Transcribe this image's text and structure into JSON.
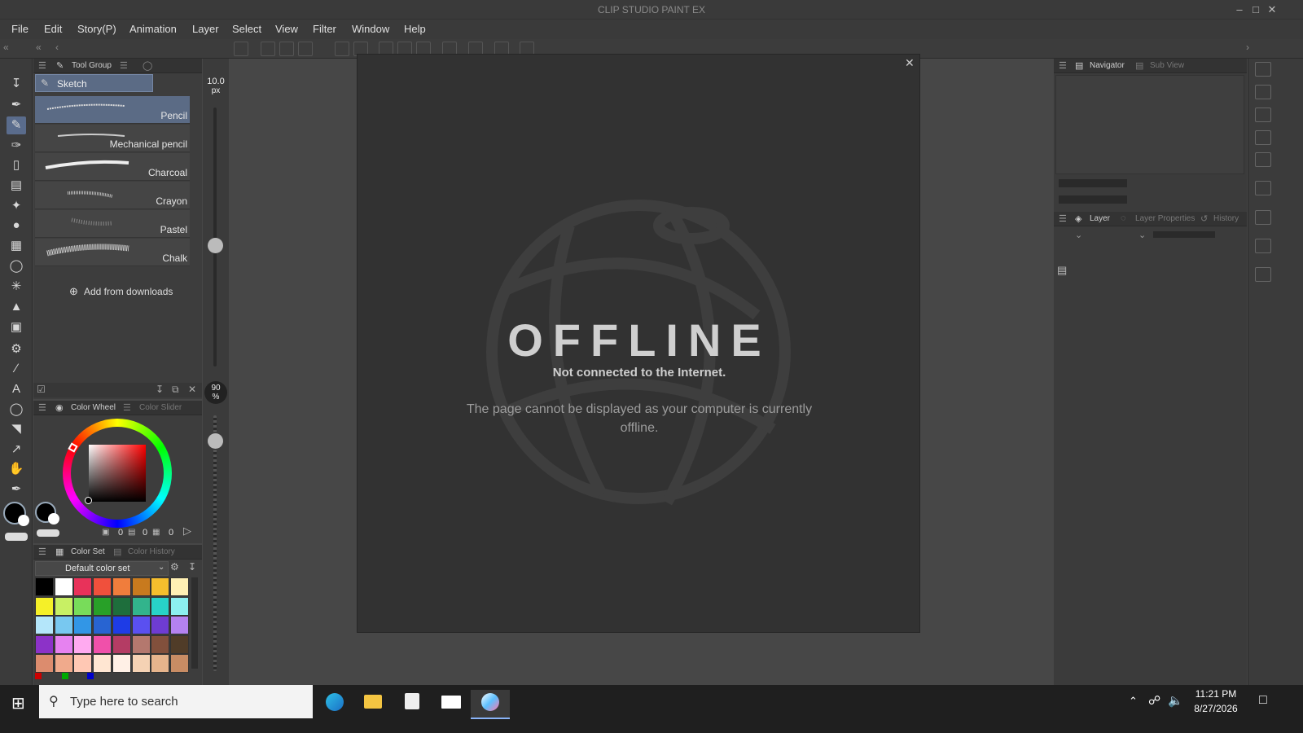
{
  "window": {
    "title": "CLIP STUDIO PAINT EX"
  },
  "menu": [
    "File",
    "Edit",
    "Story(P)",
    "Animation",
    "Layer",
    "Select",
    "View",
    "Filter",
    "Window",
    "Help"
  ],
  "subtool": {
    "tab_label": "Tool Group",
    "group_name": "Sketch",
    "brushes": [
      "Pencil",
      "Mechanical pencil",
      "Charcoal",
      "Crayon",
      "Pastel",
      "Chalk"
    ],
    "selected": "Pencil",
    "add_label": "Add from downloads"
  },
  "brush_size": {
    "value": "10.0",
    "unit": "px"
  },
  "opacity": {
    "value": "90",
    "unit": "%"
  },
  "color_panel": {
    "tab_wheel": "Color Wheel",
    "tab_slider": "Color Slider",
    "readouts": [
      "0",
      "0",
      "0"
    ]
  },
  "color_set": {
    "tab_set": "Color Set",
    "tab_history": "Color History",
    "selected": "Default color set",
    "rows": [
      [
        "#000000",
        "#ffffff",
        "#e8325a",
        "#f0503c",
        "#f07d3c",
        "#c87a1e",
        "#f5be2d",
        "#fff0b4"
      ],
      [
        "#f5f028",
        "#c8f064",
        "#78dc5a",
        "#28a028",
        "#1e6e3c",
        "#32b48c",
        "#28d2c8",
        "#8cf0f0"
      ],
      [
        "#b4e6fa",
        "#78c8f0",
        "#3296e6",
        "#2864d2",
        "#1e3ce6",
        "#5a50f0",
        "#6e3cd2",
        "#b482f0"
      ],
      [
        "#8c32c8",
        "#e682f0",
        "#ffaaf0",
        "#f050aa",
        "#b43c64",
        "#b4786e",
        "#82503c",
        "#503c28"
      ],
      [
        "#dc8c6e",
        "#f0aa8c",
        "#ffc8b4",
        "#ffe6d2",
        "#fff0e6",
        "#f5d2b4",
        "#e6b48c",
        "#c88c64"
      ]
    ]
  },
  "canvas_message": {
    "heading": "OFFLINE",
    "subheading": "Not connected to the Internet.",
    "body": "The page cannot be displayed as your computer is currently offline."
  },
  "right_panels": {
    "navigator_tab": "Navigator",
    "subview_tab": "Sub View",
    "layer_tab": "Layer",
    "layer_props_tab": "Layer Properties",
    "history_tab": "History"
  },
  "taskbar": {
    "search_placeholder": "Type here to search",
    "time": "11:21 PM",
    "date": "8/27/2026"
  },
  "colors": {
    "main": "#000000",
    "sub": "#ffffff",
    "accent": "#5b6b85"
  }
}
